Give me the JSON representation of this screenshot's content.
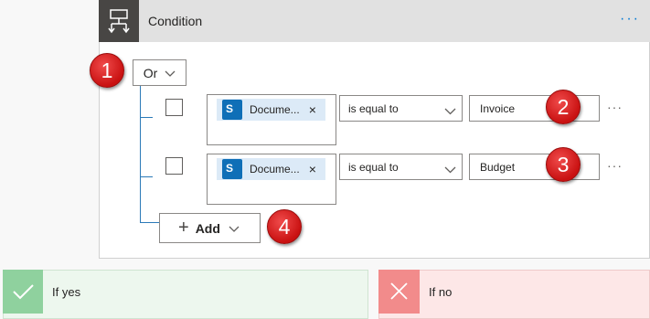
{
  "condition": {
    "title": "Condition",
    "more_label": "···",
    "group_operator": "Or",
    "rows": [
      {
        "field": "Docume...",
        "remove": "×",
        "operator": "is equal to",
        "value": "Invoice",
        "more": "···"
      },
      {
        "field": "Docume...",
        "remove": "×",
        "operator": "is equal to",
        "value": "Budget",
        "more": "···"
      }
    ],
    "add_label": "Add",
    "add_plus": "+"
  },
  "badges": [
    "1",
    "2",
    "3",
    "4"
  ],
  "branches": {
    "yes_label": "If yes",
    "no_label": "If no"
  },
  "icons": {
    "condition": "condition-icon",
    "sharepoint": "sharepoint-icon",
    "chevron": "chevron-down-icon",
    "check": "check-icon",
    "cross": "cross-icon"
  },
  "colors": {
    "header_bg": "#e1e1e1",
    "icon_bg": "#484644",
    "accent": "#0078d4",
    "badge": "#d61f1f",
    "yes_bg": "#edf7ee",
    "no_bg": "#fde7e7"
  }
}
